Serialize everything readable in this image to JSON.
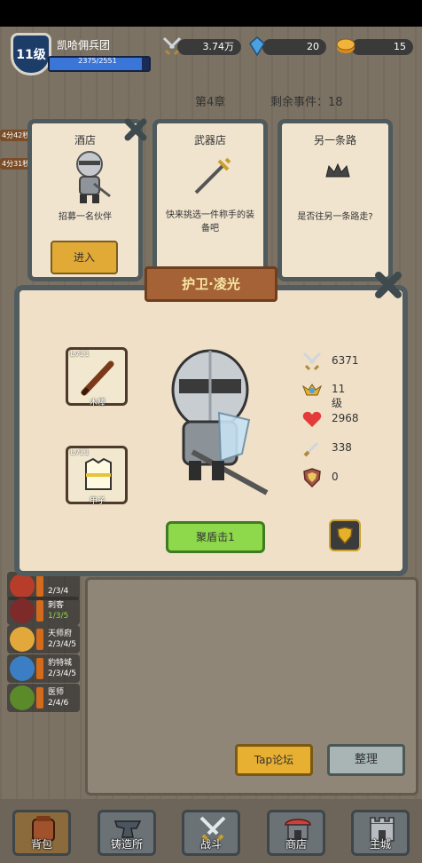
{
  "header": {
    "level": "11级",
    "team_name": "凯哈佣兵团",
    "exp": "2375/2551",
    "exp_ratio": 0.93,
    "power": "3.74万",
    "gems": "20",
    "coins": "15"
  },
  "chapter": {
    "title": "第4章",
    "remaining_label": "剩余事件：18"
  },
  "timers": [
    "4分42秒",
    "4分31秒"
  ],
  "cards": [
    {
      "title": "酒店",
      "desc": "招募一名伙伴",
      "button": "进入"
    },
    {
      "title": "武器店",
      "desc": "快来挑选一件称手的装备吧"
    },
    {
      "title": "另一条路",
      "desc": "是否往另一条路走?"
    }
  ],
  "modal": {
    "title": "护卫·凌光",
    "weapon": {
      "level": "Lv11",
      "name": "木棒"
    },
    "armor": {
      "level": "Lv11",
      "name": "甲子"
    },
    "stats": [
      {
        "icon": "crossed-swords-icon",
        "value": "6371"
      },
      {
        "icon": "winged-helmet-icon",
        "value": "11级"
      },
      {
        "icon": "heart-icon",
        "value": "2968"
      },
      {
        "icon": "sword-icon",
        "value": "338"
      },
      {
        "icon": "shield-icon",
        "value": "0"
      }
    ],
    "skill_button": "聚盾击1"
  },
  "side_list": [
    {
      "name": "",
      "count": "2/3/4"
    },
    {
      "name": "刺客",
      "count": "1/3/5"
    },
    {
      "name": "天师府",
      "count": "2/3/4/5"
    },
    {
      "name": "豹特城",
      "count": "2/3/4/5"
    },
    {
      "name": "医师",
      "count": "2/4/6"
    }
  ],
  "buttons": {
    "tap_forum": "Tap论坛",
    "sort": "整理"
  },
  "nav": [
    {
      "label": "背包",
      "icon": "backpack-icon"
    },
    {
      "label": "铸造所",
      "icon": "anvil-icon"
    },
    {
      "label": "战斗",
      "icon": "crossed-swords-icon"
    },
    {
      "label": "商店",
      "icon": "shop-icon"
    },
    {
      "label": "主城",
      "icon": "castle-icon"
    }
  ],
  "colors": {
    "modal_bg": "#efe0c7",
    "skill_green": "#8ed84c",
    "gold": "#e8b032"
  }
}
